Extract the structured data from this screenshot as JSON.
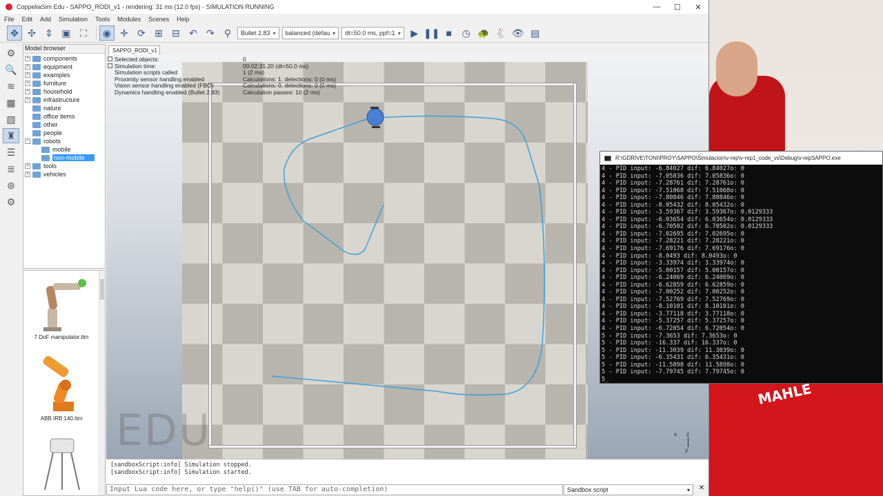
{
  "window": {
    "title": "CoppeliaSim Edu - SAPPO_RODI_v1 - rendering: 31 ms (12.0 fps) - SIMULATION RUNNING",
    "controls": [
      "—",
      "☐",
      "✕"
    ]
  },
  "menu": [
    "File",
    "Edit",
    "Add",
    "Simulation",
    "Tools",
    "Modules",
    "Scenes",
    "Help"
  ],
  "toolbar": {
    "engine": "Bullet 2.83",
    "mode": "balanced (defau",
    "dt": "dt=50.0 ms, ppf=1"
  },
  "model_browser": {
    "header": "Model browser",
    "items": [
      {
        "label": "components",
        "expand": "+"
      },
      {
        "label": "equipment",
        "expand": "+"
      },
      {
        "label": "examples",
        "expand": "+"
      },
      {
        "label": "furniture",
        "expand": "+"
      },
      {
        "label": "household",
        "expand": "+"
      },
      {
        "label": "infrastructure",
        "expand": "+"
      },
      {
        "label": "nature",
        "expand": ""
      },
      {
        "label": "office items",
        "expand": ""
      },
      {
        "label": "other",
        "expand": ""
      },
      {
        "label": "people",
        "expand": ""
      },
      {
        "label": "robots",
        "expand": "−"
      },
      {
        "label": "mobile",
        "expand": ""
      },
      {
        "label": "non-mobile",
        "expand": ""
      },
      {
        "label": "tools",
        "expand": "+"
      },
      {
        "label": "vehicles",
        "expand": "+"
      }
    ]
  },
  "thumbnails": [
    {
      "label": "7 DoF manipulator.ttm"
    },
    {
      "label": "ABB IRB 140.ttm"
    }
  ],
  "scene_tab": "SAPPO_RODI_v1",
  "sim_info": [
    {
      "key": "Selected objects:",
      "value": "0"
    },
    {
      "key": "Simulation time:",
      "value": "00:02:31.20 (dt=50.0 ms)"
    },
    {
      "key": "Simulation scripts called",
      "value": "1 (2 ms)"
    },
    {
      "key": "Proximity sensor handling enabled",
      "value": "Calculations: 1, detections: 0 (0 ms)"
    },
    {
      "key": "Vision sensor handling enabled (FBO)",
      "value": "Calculations: 0, detections: 0 (0 ms)"
    },
    {
      "key": "Dynamics handling enabled (Bullet 2.83)",
      "value": "Calculation passes: 10 (2 ms)"
    }
  ],
  "watermark": "EDU",
  "axes": {
    "x": "x",
    "z": "z",
    "y": "y"
  },
  "console": [
    "[sandboxScript:info] Simulation stopped.",
    "[sandboxScript:info] Simulation started."
  ],
  "lua_input_placeholder": "Input Lua code here, or type \"help()\" (use TAB for auto-completion)",
  "script_select": "Sandbox script",
  "close_label": "✕",
  "terminal": {
    "title": "R:\\GDRIVE\\TONI\\PROY\\SAPPO\\Simulacion\\v-rep\\v-rep1_code_vs\\Debug\\v-repSAPPO.exe",
    "lines": [
      "4 - PID input: -6.84027 dif: 6.84027o: 0",
      "4 - PID input: -7.05836 dif: 7.05836o: 0",
      "4 - PID input: -7.28761 dif: 7.28761o: 0",
      "4 - PID input: -7.51068 dif: 7.51068o: 0",
      "4 - PID input: -7.80846 dif: 7.80846o: 0",
      "4 - PID input: -8.05432 dif: 8.05432o: 0",
      "4 - PID input: -3.59367 dif: 3.59367o: 0.0129333",
      "4 - PID input: -6.03654 dif: 6.03654o: 0.0129333",
      "4 - PID input: -6.70502 dif: 6.70502o: 0.0129333",
      "4 - PID input: -7.02695 dif: 7.02695o: 0",
      "4 - PID input: -7.28221 dif: 7.28221o: 0",
      "4 - PID input: -7.69176 dif: 7.69176o: 0",
      "4 - PID input: -8.0493 dif: 8.0493o: 0",
      "4 - PID input: -3.33974 dif: 3.33974o: 0",
      "4 - PID input: -5.00157 dif: 5.00157o: 0",
      "4 - PID input: -6.24069 dif: 6.24069o: 0",
      "4 - PID input: -6.62859 dif: 6.62859o: 0",
      "4 - PID input: -7.00252 dif: 7.00252o: 0",
      "4 - PID input: -7.52769 dif: 7.52769o: 0",
      "4 - PID input: -8.10101 dif: 8.10101o: 0",
      "4 - PID input: -3.77118 dif: 3.77118o: 0",
      "4 - PID input: -5.37257 dif: 5.37257o: 0",
      "4 - PID input: -6.72054 dif: 6.72054o: 0",
      "5 - PID input: -7.3653 dif: 7.3653o: 0",
      "5 - PID input: -16.337 dif: 16.337o: 0",
      "5 - PID input: -11.3039 dif: 11.3039o: 0",
      "5 - PID input: -6.35431 dif: 6.35431o: 0",
      "5 - PID input: -11.5898 dif: 11.5898o: 0",
      "5 - PID input: -7.79745 dif: 7.79745o: 0",
      "5_"
    ]
  },
  "background": {
    "car_text": "MAHLE"
  },
  "colors": {
    "accent": "#3399ff",
    "path": "#3aa0d8",
    "robot": "#4a7fd8"
  }
}
